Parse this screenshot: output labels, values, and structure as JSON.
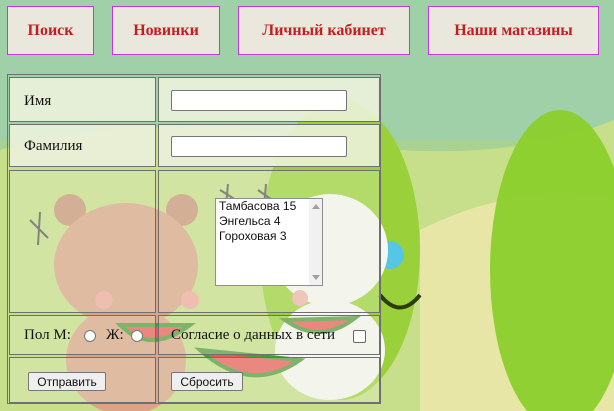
{
  "nav": {
    "items": [
      {
        "label": "Поиск"
      },
      {
        "label": "Новинки"
      },
      {
        "label": "Личный кабинет"
      },
      {
        "label": "Наши магазины"
      }
    ]
  },
  "form": {
    "name_label": "Имя",
    "name_value": "",
    "surname_label": "Фамилия",
    "surname_value": "",
    "stores": [
      "Тамбасова 15",
      "Энгельса 4",
      "Гороховая 3"
    ],
    "gender_label": "Пол М:",
    "female_label": "Ж:",
    "consent_label": "Согласие о данных в сети",
    "submit_label": "Отправить",
    "reset_label": "Сбросить"
  },
  "colors": {
    "nav_text": "#c41f1f",
    "nav_border": "#c238d8",
    "cell_bg": "#ecf1dc"
  }
}
